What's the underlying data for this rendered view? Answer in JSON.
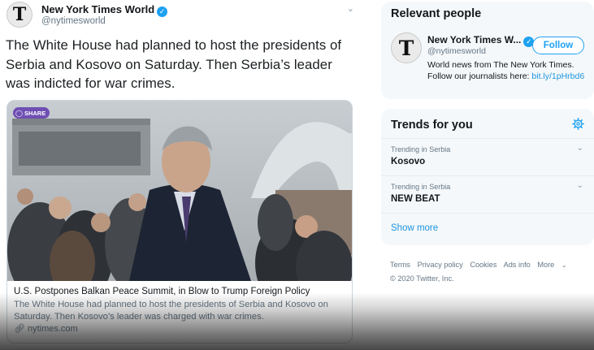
{
  "tweet": {
    "account_name": "New York Times World",
    "account_handle": "@nytimesworld",
    "avatar_letter": "T",
    "text": "The White House had planned to host the presidents of Serbia and Kosovo on Saturday. Then Serbia’s leader was indicted for war crimes.",
    "card": {
      "badge_label": "SHARE",
      "title": "U.S. Postpones Balkan Peace Summit, in Blow to Trump Foreign Policy",
      "description": "The White House had planned to host the presidents of Serbia and Kosovo on Saturday. Then Kosovo’s leader was charged with war crimes.",
      "domain": "nytimes.com"
    }
  },
  "sidebar": {
    "relevant_people": {
      "title": "Relevant people",
      "person": {
        "name": "New York Times W...",
        "handle": "@nytimesworld",
        "avatar_letter": "T",
        "follow_label": "Follow",
        "bio": "World news from The New York Times. Follow our journalists here: ",
        "bio_link": "bit.ly/1pHrbd6"
      }
    },
    "trends": {
      "title": "Trends for you",
      "items": [
        {
          "meta": "Trending in Serbia",
          "name": "Kosovo"
        },
        {
          "meta": "Trending in Serbia",
          "name": "NEW BEAT"
        }
      ],
      "show_more": "Show more"
    },
    "footer": {
      "links": [
        "Terms",
        "Privacy policy",
        "Cookies",
        "Ads info",
        "More"
      ],
      "copyright": "© 2020 Twitter, Inc."
    }
  },
  "colors": {
    "accent": "#1da1f2",
    "link": "#1b95e0",
    "panel_bg": "#f5f8fa",
    "verified": "#1da1f2",
    "share_badge": "#6f4fb3"
  },
  "icons": {
    "verified": "verified-badge-icon",
    "caret": "chevron-down-icon",
    "gear": "gear-icon",
    "link": "link-icon"
  }
}
